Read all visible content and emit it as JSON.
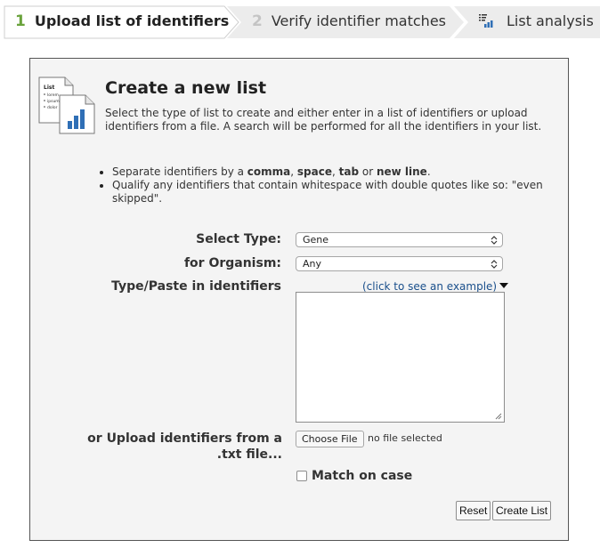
{
  "steps": [
    {
      "number": "1",
      "label": "Upload list of identifiers",
      "state": "active"
    },
    {
      "number": "2",
      "label": "Verify identifier matches",
      "state": "inactive"
    },
    {
      "icon": "list-analysis-icon",
      "label": "List analysis",
      "state": "inactive"
    }
  ],
  "panel": {
    "title": "Create a new list",
    "description": "Select the type of list to create and either enter in a list of identifiers or upload identifiers from a file. A search will be performed for all the identifiers in your list.",
    "icon_text": [
      "List",
      "lorem",
      "ipsum",
      "dolor"
    ]
  },
  "tips": {
    "t1_prefix": "Separate identifiers by a ",
    "t1_comma": "comma",
    "t1_sep1": ", ",
    "t1_space": "space",
    "t1_sep2": ", ",
    "t1_tab": "tab",
    "t1_sep3": " or ",
    "t1_newline": "new line",
    "t1_suffix": ".",
    "t2": "Qualify any identifiers that contain whitespace with double quotes like so: \"even skipped\"."
  },
  "form": {
    "select_type_label": "Select Type:",
    "select_type_value": "Gene",
    "organism_label": "for Organism:",
    "organism_value": "Any",
    "paste_label": "Type/Paste in identifiers",
    "example_link": "(click to see an example)",
    "identifiers_value": "",
    "upload_label": "or Upload identifiers from a .txt file...",
    "choose_file_label": "Choose File",
    "file_status": "no file selected",
    "match_case_label": "Match on case",
    "match_case_checked": false
  },
  "buttons": {
    "reset": "Reset",
    "create": "Create List"
  },
  "colors": {
    "step_active_number": "#6aa33c",
    "step_inactive_number": "#c4c4c4",
    "step_bar": "#ececec",
    "link": "#1a4f8b",
    "panel_bg": "#f4f4f4"
  }
}
